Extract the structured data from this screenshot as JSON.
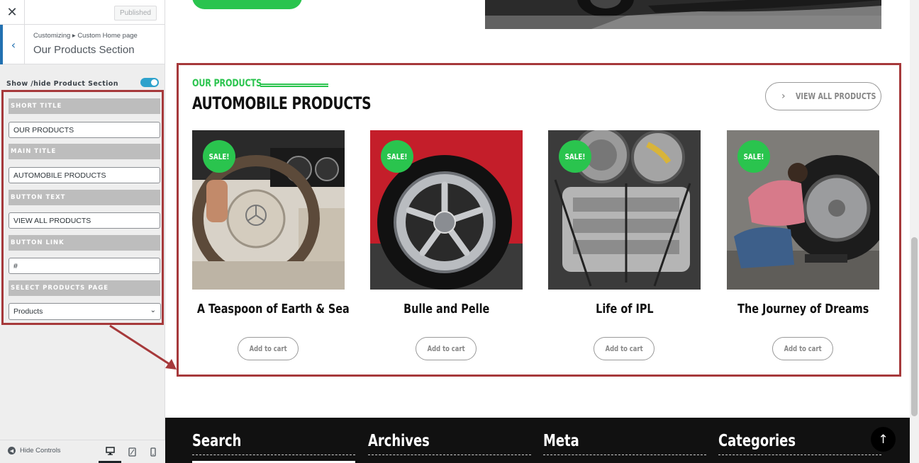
{
  "sidebar": {
    "close_icon": "close-icon",
    "published_label": "Published",
    "breadcrumb": "Customizing ▸ Custom Home page",
    "section_title": "Our Products Section",
    "toggle_label": "Show /hide Product Section",
    "toggle_on": true,
    "fields": {
      "short_title_label": "SHORT TITLE",
      "short_title_value": "OUR PRODUCTS",
      "main_title_label": "MAIN TITLE",
      "main_title_value": "AUTOMOBILE PRODUCTS",
      "button_text_label": "BUTTON TEXT",
      "button_text_value": "VIEW ALL PRODUCTS",
      "button_link_label": "BUTTON LINK",
      "button_link_value": "#",
      "select_page_label": "SELECT PRODUCTS PAGE",
      "select_page_value": "Products"
    },
    "footer": {
      "hide_controls": "Hide Controls",
      "devices": [
        "desktop-icon",
        "tablet-icon",
        "mobile-icon"
      ]
    }
  },
  "preview": {
    "products": {
      "short_title": "OUR PRODUCTS",
      "main_title": "AUTOMOBILE PRODUCTS",
      "view_all": "VIEW ALL PRODUCTS",
      "items": [
        {
          "name": "A Teaspoon of Earth & Sea",
          "badge": "SALE!",
          "cart": "Add to cart"
        },
        {
          "name": "Bulle and Pelle",
          "badge": "SALE!",
          "cart": "Add to cart"
        },
        {
          "name": "Life of IPL",
          "badge": "SALE!",
          "cart": "Add to cart"
        },
        {
          "name": "The Journey of Dreams",
          "badge": "SALE!",
          "cart": "Add to cart"
        }
      ]
    },
    "footer": {
      "columns": [
        "Search",
        "Archives",
        "Meta",
        "Categories"
      ]
    }
  },
  "colors": {
    "accent_green": "#2ac44e",
    "highlight_red": "#a6393b",
    "wp_blue": "#2271b1"
  }
}
